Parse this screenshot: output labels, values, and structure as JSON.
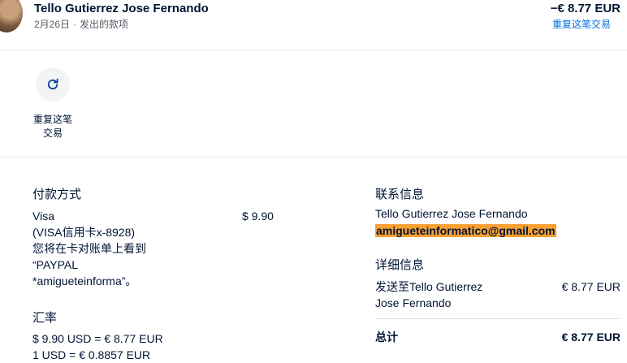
{
  "header": {
    "name": "Tello Gutierrez Jose Fernando",
    "date": "2月26日",
    "separator": "·",
    "type": "发出的款项",
    "amount": "−€ 8.77 EUR",
    "repeat_link": "重复这笔交易"
  },
  "actions": {
    "repeat_label_line1": "重复这笔",
    "repeat_label_line2": "交易",
    "repeat_icon": "refresh-icon"
  },
  "payment": {
    "title": "付款方式",
    "method": "Visa",
    "card": "(VISA信用卡x-8928)",
    "statement_line1": "您将在卡对账单上看到",
    "statement_line2": "“PAYPAL",
    "statement_line3": "*amigueteinforma”。",
    "amount": "$ 9.90"
  },
  "exchange": {
    "title": "汇率",
    "line1": "$ 9.90 USD = € 8.77 EUR",
    "line2": "1 USD = € 0.8857 EUR"
  },
  "contact": {
    "title": "联系信息",
    "name": "Tello Gutierrez Jose Fernando",
    "email": "amigueteinformatico@gmail.com"
  },
  "details": {
    "title": "详细信息",
    "sent_to_line1": "发送至Tello Gutierrez",
    "sent_to_line2": "Jose Fernando",
    "sent_amount": "€ 8.77 EUR",
    "total_label": "总计",
    "total_amount": "€ 8.77 EUR"
  },
  "colors": {
    "link": "#0070e0",
    "highlight": "#f7a033",
    "text": "#001435"
  }
}
